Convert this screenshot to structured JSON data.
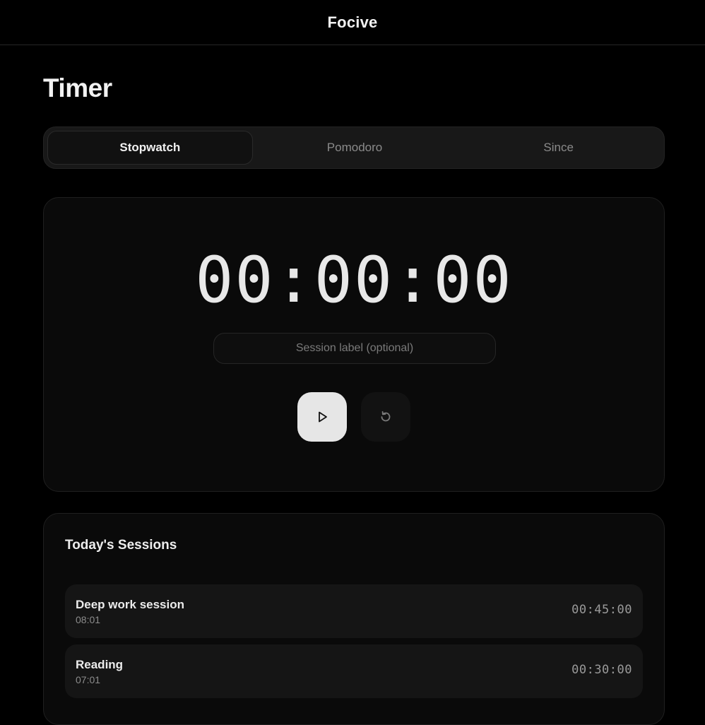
{
  "app": {
    "title": "Focive"
  },
  "page": {
    "title": "Timer"
  },
  "tabs": [
    {
      "label": "Stopwatch",
      "active": true
    },
    {
      "label": "Pomodoro",
      "active": false
    },
    {
      "label": "Since",
      "active": false
    }
  ],
  "timer": {
    "display": "00:00:00",
    "label_placeholder": "Session label (optional)",
    "label_value": "",
    "play_icon": "play-icon",
    "reset_icon": "reset-icon"
  },
  "sessions": {
    "title": "Today's Sessions",
    "items": [
      {
        "name": "Deep work session",
        "time": "08:01",
        "duration": "00:45:00"
      },
      {
        "name": "Reading",
        "time": "07:01",
        "duration": "00:30:00"
      }
    ]
  },
  "colors": {
    "background": "#000000",
    "card": "#0a0a0a",
    "play_button": "#e6e6e6",
    "text": "#ececec",
    "muted": "#8a8a8a"
  }
}
